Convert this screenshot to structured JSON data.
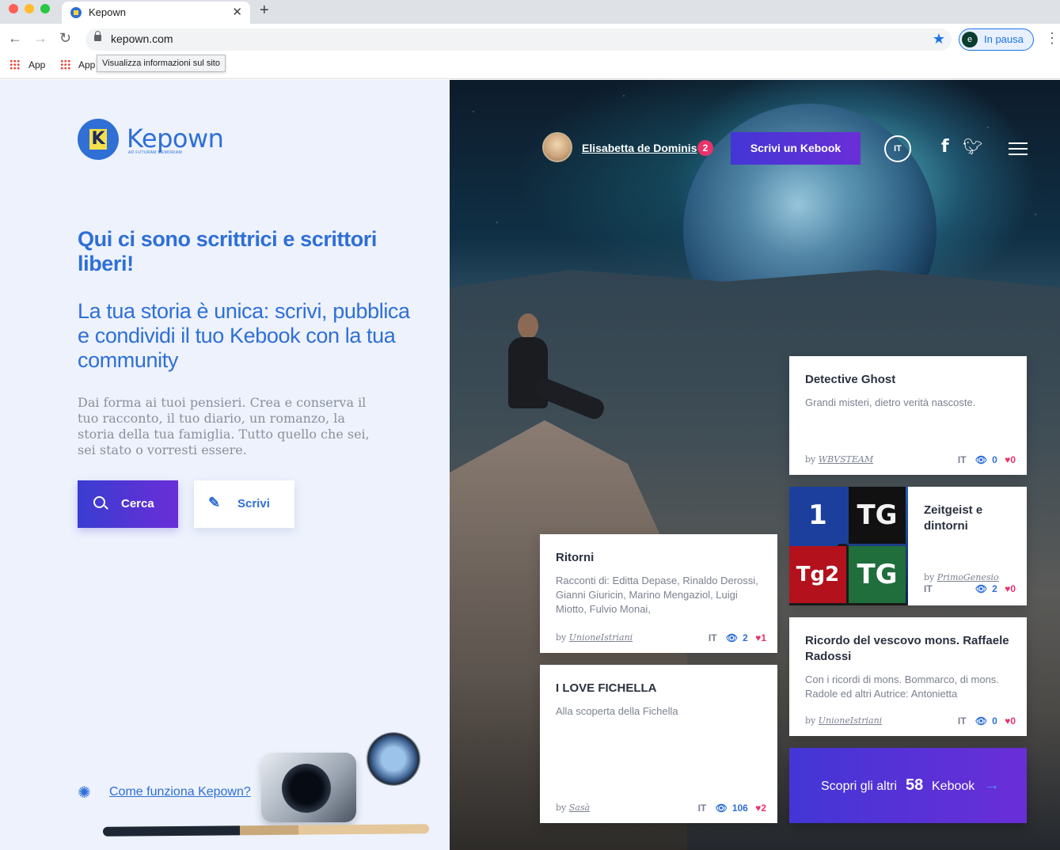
{
  "browser": {
    "tab_title": "Kepown",
    "url": "kepown.com",
    "profile_initial": "e",
    "profile_status": "In pausa",
    "bookmarks": [
      "App",
      "App"
    ],
    "tooltip": "Visualizza informazioni sul sito"
  },
  "brand": {
    "name": "Kepown",
    "tagline": "AD FUTURAM MEMORIAM",
    "primary_color": "#2f6fd6",
    "accent_color": "#6a2ed7"
  },
  "hero": {
    "title": "Qui ci sono scrittrici e scrittori liberi!",
    "subtitle": "La tua storia è unica: scrivi, pubblica e condividi il tuo Kebook con la tua community",
    "lead": "Dai forma ai tuoi pensieri. Crea e conserva il tuo racconto, il tuo diario, un romanzo, la storia della tua famiglia. Tutto quello che sei, sei stato o vorresti essere.",
    "search_button": "Cerca",
    "write_button": "Scrivi",
    "how_link": "Come funziona Kepown?"
  },
  "nav": {
    "user_name": "Elisabetta de Dominis",
    "notifications": "2",
    "cta": "Scrivi un Kebook",
    "language": "IT"
  },
  "cards": [
    {
      "title": "Detective Ghost",
      "desc": "Grandi misteri, dietro verità nascoste.",
      "by_prefix": "by",
      "author": "WBVSTEAM",
      "lang": "IT",
      "views": "0",
      "likes": "0"
    },
    {
      "title": "Zeitgeist e dintorni",
      "desc": "",
      "by_prefix": "by",
      "author": "PrimoGenesio",
      "lang": "IT",
      "views": "2",
      "likes": "0"
    },
    {
      "title": "Ritorni",
      "desc": "Racconti di: Editta Depase, Rinaldo Derossi, Gianni Giuricin, Marino Mengaziol, Luigi Miotto, Fulvio Monai,",
      "by_prefix": "by",
      "author": "UnioneIstriani",
      "lang": "IT",
      "views": "2",
      "likes": "1"
    },
    {
      "title": "Ricordo del vescovo mons. Raffaele Radossi",
      "desc": "Con i ricordi di mons. Bommarco, di mons. Radole ed altri Autrice: Antonietta",
      "by_prefix": "by",
      "author": "UnioneIstriani",
      "lang": "IT",
      "views": "0",
      "likes": "0"
    },
    {
      "title": "I LOVE FICHELLA",
      "desc": "Alla scoperta della Fichella",
      "by_prefix": "by",
      "author": "Sasà",
      "lang": "IT",
      "views": "106",
      "likes": "2"
    }
  ],
  "cover_labels": [
    "1",
    "TG",
    "Tg2",
    "TG"
  ],
  "more": {
    "prefix": "Scopri gli altri",
    "count": "58",
    "suffix": "Kebook"
  }
}
